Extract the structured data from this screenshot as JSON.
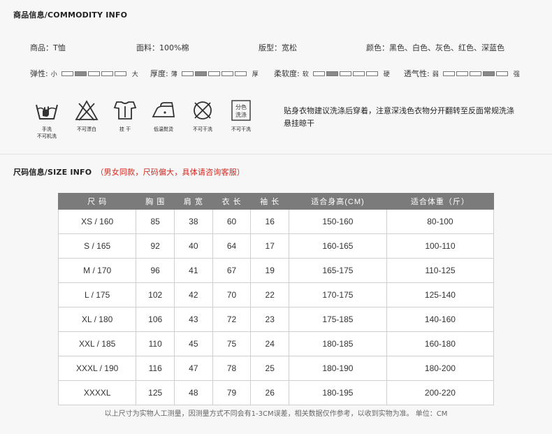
{
  "commodity": {
    "title": "商品信息/COMMODITY INFO",
    "product": "商品：T恤",
    "fabric": "面料：100%棉",
    "fit": "版型：宽松",
    "colors": "颜色：黑色、白色、灰色、红色、深蓝色"
  },
  "scales": [
    {
      "label": "弹性:",
      "low": "小",
      "high": "大",
      "level": 2,
      "of": 5
    },
    {
      "label": "厚度:",
      "low": "薄",
      "high": "厚",
      "level": 2,
      "of": 5
    },
    {
      "label": "柔软度:",
      "low": "软",
      "high": "硬",
      "level": 2,
      "of": 5
    },
    {
      "label": "透气性:",
      "low": "弱",
      "high": "强",
      "level": 4,
      "of": 5
    }
  ],
  "care": [
    {
      "icon": "hand-wash-icon",
      "caption": "手洗\n不可机洗"
    },
    {
      "icon": "no-bleach-icon",
      "caption": "不可漂白"
    },
    {
      "icon": "hang-dry-icon",
      "caption": "挂  干"
    },
    {
      "icon": "low-iron-icon",
      "caption": "低温熨烫"
    },
    {
      "icon": "no-tumble-dry-icon",
      "caption": "不可干洗"
    },
    {
      "icon": "separate-wash-icon",
      "caption": "不可干洗",
      "icon_text": "分色\n洗涤"
    }
  ],
  "care_tip": "贴身衣物建议洗涤后穿着，注意深浅色衣物分开翻转至反面常规洗涤悬挂晾干",
  "size": {
    "title": "尺码信息/SIZE INFO",
    "note": "（男女同款，尺码偏大，具体请咨询客服）",
    "headers": [
      "尺 码",
      "胸 围",
      "肩 宽",
      "衣 长",
      "袖 长",
      "适合身高(CM)",
      "适合体重（斤）"
    ],
    "rows": [
      [
        "XS / 160",
        "85",
        "38",
        "60",
        "16",
        "150-160",
        "80-100"
      ],
      [
        "S / 165",
        "92",
        "40",
        "64",
        "17",
        "160-165",
        "100-110"
      ],
      [
        "M / 170",
        "96",
        "41",
        "67",
        "19",
        "165-175",
        "110-125"
      ],
      [
        "L / 175",
        "102",
        "42",
        "70",
        "22",
        "170-175",
        "125-140"
      ],
      [
        "XL / 180",
        "106",
        "43",
        "72",
        "23",
        "175-185",
        "140-160"
      ],
      [
        "XXL / 185",
        "110",
        "45",
        "75",
        "24",
        "180-185",
        "160-180"
      ],
      [
        "XXXL / 190",
        "116",
        "47",
        "78",
        "25",
        "180-190",
        "180-200"
      ],
      [
        "XXXXL",
        "125",
        "48",
        "79",
        "26",
        "180-195",
        "200-220"
      ]
    ]
  },
  "footnote": "以上尺寸为实物人工测量，因测量方式不同会有1-3CM误差，相关数据仅作参考，以收到实物为准。  单位：CM"
}
